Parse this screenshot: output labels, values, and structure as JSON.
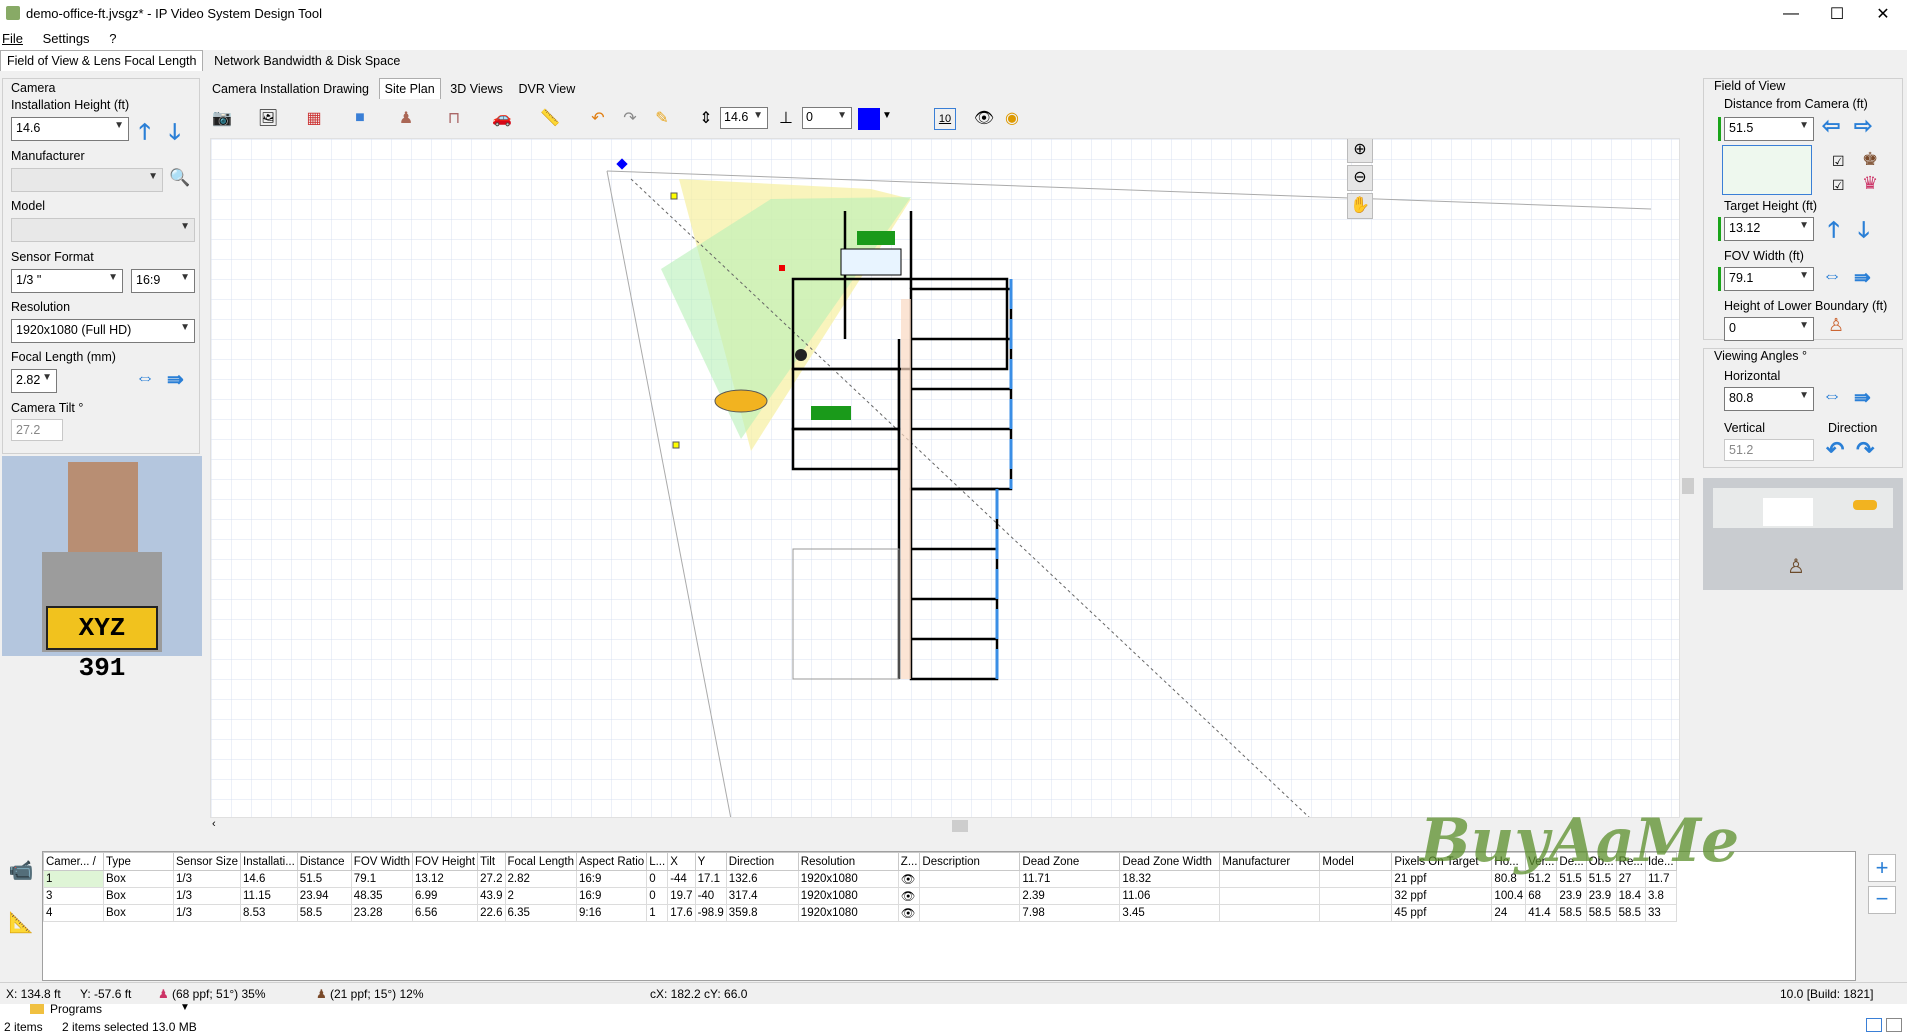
{
  "window": {
    "title": "demo-office-ft.jvsgz* - IP Video System Design Tool",
    "minimize": "—",
    "maximize": "☐",
    "close": "✕"
  },
  "menu": [
    "File",
    "Settings",
    "?"
  ],
  "main_tabs": [
    {
      "label": "Field of View & Lens Focal Length",
      "active": true
    },
    {
      "label": "Network Bandwidth & Disk Space",
      "active": false
    }
  ],
  "left_panel": {
    "group_label": "Camera",
    "installation_height_label": "Installation Height (ft)",
    "installation_height_value": "14.6",
    "manufacturer_label": "Manufacturer",
    "manufacturer_value": "",
    "model_label": "Model",
    "model_value": "",
    "sensor_format_label": "Sensor Format",
    "sensor_format_value": "1/3 \"",
    "aspect_value": "16:9",
    "resolution_label": "Resolution",
    "resolution_value": "1920x1080 (Full HD)",
    "focal_length_label": "Focal Length (mm)",
    "focal_length_value": "2.82",
    "camera_tilt_label": "Camera Tilt °",
    "camera_tilt_value": "27.2",
    "plate_text": "XYZ 391"
  },
  "sub_tabs": [
    {
      "label": "Camera Installation Drawing",
      "active": false
    },
    {
      "label": "Site Plan",
      "active": true
    },
    {
      "label": "3D Views",
      "active": false
    },
    {
      "label": "DVR View",
      "active": false
    }
  ],
  "toolbar": {
    "height_value": "14.6",
    "elev_value": "0",
    "grid_value": "10"
  },
  "right_panel": {
    "group_label": "Field of View",
    "distance_label": "Distance from Camera  (ft)",
    "distance_value": "51.5",
    "target_height_label": "Target Height (ft)",
    "target_height_value": "13.12",
    "fov_width_label": "FOV Width (ft)",
    "fov_width_value": "79.1",
    "lower_boundary_label": "Height of Lower Boundary  (ft)",
    "lower_boundary_value": "0",
    "viewing_angles_label": "Viewing Angles °",
    "horizontal_label": "Horizontal",
    "horizontal_value": "80.8",
    "vertical_label": "Vertical",
    "vertical_value": "51.2",
    "direction_label": "Direction"
  },
  "table": {
    "headers": [
      "Camer... /",
      "Type",
      "Sensor Size",
      "Installati...",
      "Distance",
      "FOV Width",
      "FOV Height",
      "Tilt",
      "Focal Length",
      "Aspect Ratio",
      "L...",
      "X",
      "Y",
      "Direction",
      "Resolution",
      "Z...",
      "Description",
      "Dead Zone",
      "Dead Zone Width",
      "Manufacturer",
      "Model",
      "Pixels On Target",
      "Ho...",
      "Ver...",
      "De...",
      "Ob...",
      "Re...",
      "Ide..."
    ],
    "rows": [
      [
        "1",
        "Box",
        "1/3",
        "14.6",
        "51.5",
        "79.1",
        "13.12",
        "27.2",
        "2.82",
        "16:9",
        "0",
        "-44",
        "17.1",
        "132.6",
        "1920x1080",
        "👁",
        "",
        "11.71",
        "18.32",
        "",
        "",
        "21 ppf",
        "80.8",
        "51.2",
        "51.5",
        "51.5",
        "27",
        "11.7"
      ],
      [
        "3",
        "Box",
        "1/3",
        "11.15",
        "23.94",
        "48.35",
        "6.99",
        "43.9",
        "2",
        "16:9",
        "0",
        "19.7",
        "-40",
        "317.4",
        "1920x1080",
        "👁",
        "",
        "2.39",
        "11.06",
        "",
        "",
        "32 ppf",
        "100.4",
        "68",
        "23.9",
        "23.9",
        "18.4",
        "3.8"
      ],
      [
        "4",
        "Box",
        "1/3",
        "8.53",
        "58.5",
        "23.28",
        "6.56",
        "22.6",
        "6.35",
        "9:16",
        "1",
        "17.6",
        "-98.9",
        "359.8",
        "1920x1080",
        "👁",
        "",
        "7.98",
        "3.45",
        "",
        "",
        "45 ppf",
        "24",
        "41.4",
        "58.5",
        "58.5",
        "58.5",
        "33"
      ]
    ]
  },
  "status": {
    "x": "X: 134.8 ft",
    "y": "Y: -57.6 ft",
    "ppf1": "(68 ppf; 51°) 35%",
    "ppf2": "(21 ppf; 15°)  12%",
    "cxy": "cX: 182.2 cY: 66.0",
    "build": "10.0 [Build: 1821]"
  },
  "explorer": {
    "folder": "Programs",
    "items": "2 items",
    "selected": "2 items selected  13.0 MB"
  },
  "watermark": "BuyAaMe"
}
